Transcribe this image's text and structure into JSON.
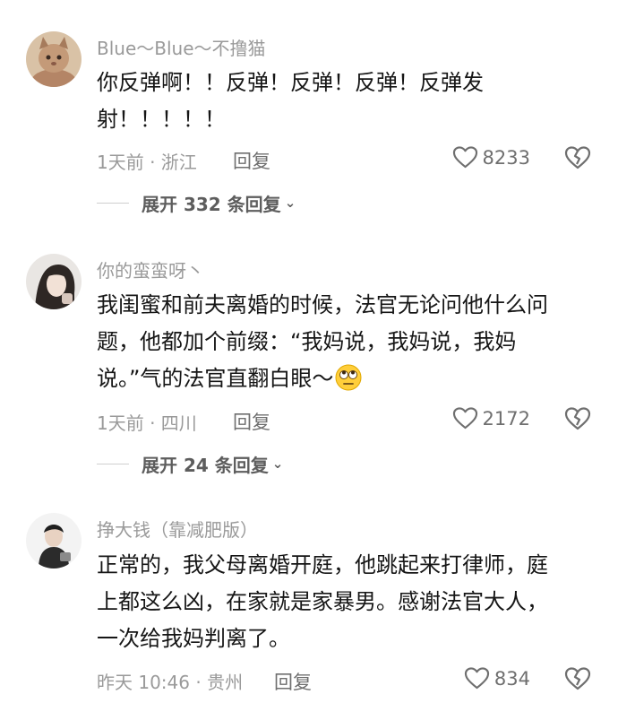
{
  "comments": [
    {
      "username": "Blue～Blue～不撸猫",
      "text": "你反弹啊！！反弹！反弹！反弹！反弹发\n射！！！！！",
      "meta": "1天前 · 浙江",
      "reply_label": "回复",
      "likes": "8233",
      "expand_label": "展开 332 条回复"
    },
    {
      "username": "你的蛮蛮呀丶",
      "text": "我闺蜜和前夫离婚的时候，法官无论问他什么问\n题，他都加个前缀：“我妈说，我妈说，我妈\n说。”气的法官直翻白眼～",
      "meta": "1天前 · 四川",
      "reply_label": "回复",
      "likes": "2172",
      "expand_label": "展开 24 条回复"
    },
    {
      "username": "挣大钱（靠减肥版）",
      "text": "正常的，我父母离婚开庭，他跳起来打律师，庭\n上都这么凶，在家就是家暴男。感谢法官大人，\n一次给我妈判离了。",
      "meta": "昨天 10:46 · 贵州",
      "reply_label": "回复",
      "likes": "834"
    }
  ],
  "icons": {
    "like": "heart-outline-icon",
    "dislike": "broken-heart-icon",
    "expand": "chevron-down-icon",
    "emoji": "rolling-eyes-emoji"
  },
  "colors": {
    "text": "#161616",
    "secondary": "#9a9a9a",
    "action": "#6f6f6f"
  }
}
